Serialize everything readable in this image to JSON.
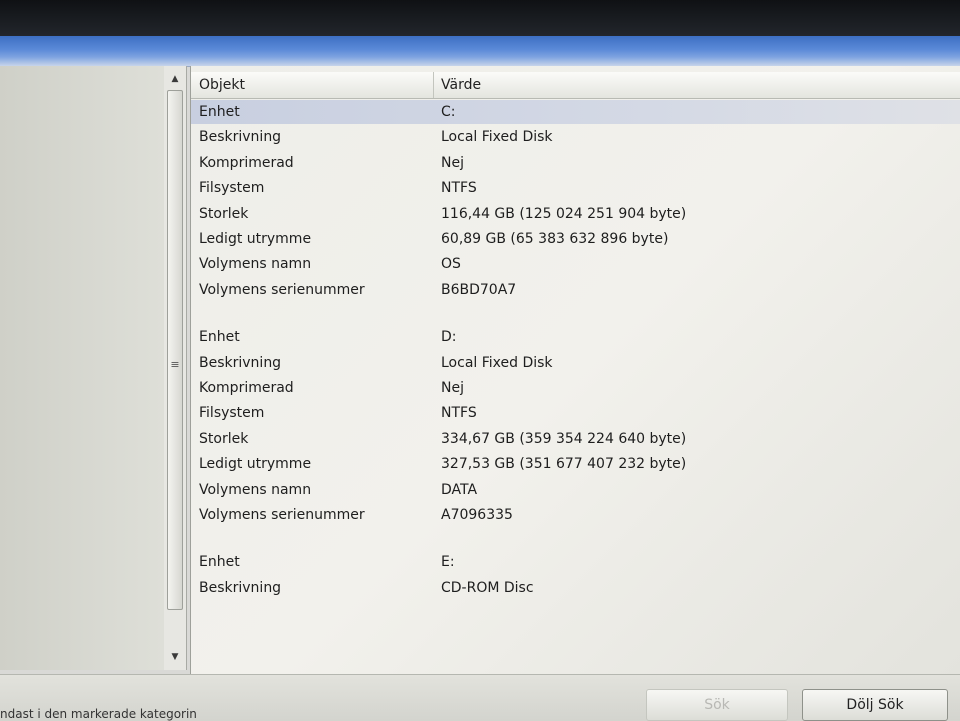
{
  "table": {
    "headers": {
      "object": "Objekt",
      "value": "Värde"
    },
    "rows": [
      {
        "object": "Enhet",
        "value": "C:",
        "selected": true
      },
      {
        "object": "Beskrivning",
        "value": "Local Fixed Disk"
      },
      {
        "object": "Komprimerad",
        "value": "Nej"
      },
      {
        "object": "Filsystem",
        "value": "NTFS"
      },
      {
        "object": "Storlek",
        "value": "116,44 GB (125 024 251 904 byte)"
      },
      {
        "object": "Ledigt utrymme",
        "value": "60,89 GB (65 383 632 896 byte)"
      },
      {
        "object": "Volymens namn",
        "value": "OS"
      },
      {
        "object": "Volymens serienummer",
        "value": "B6BD70A7"
      },
      {
        "object": "",
        "value": ""
      },
      {
        "object": "Enhet",
        "value": "D:"
      },
      {
        "object": "Beskrivning",
        "value": "Local Fixed Disk"
      },
      {
        "object": "Komprimerad",
        "value": "Nej"
      },
      {
        "object": "Filsystem",
        "value": "NTFS"
      },
      {
        "object": "Storlek",
        "value": "334,67 GB (359 354 224 640 byte)"
      },
      {
        "object": "Ledigt utrymme",
        "value": "327,53 GB (351 677 407 232 byte)"
      },
      {
        "object": "Volymens namn",
        "value": "DATA"
      },
      {
        "object": "Volymens serienummer",
        "value": "A7096335"
      },
      {
        "object": "",
        "value": ""
      },
      {
        "object": "Enhet",
        "value": "E:"
      },
      {
        "object": "Beskrivning",
        "value": "CD-ROM Disc"
      }
    ]
  },
  "scrollbar": {
    "up_icon": "▲",
    "down_icon": "▼",
    "grip_icon": "≡"
  },
  "status": {
    "text": "ndast i den markerade kategorin"
  },
  "buttons": {
    "search": "Sök",
    "hide_search": "Dölj Sök"
  }
}
